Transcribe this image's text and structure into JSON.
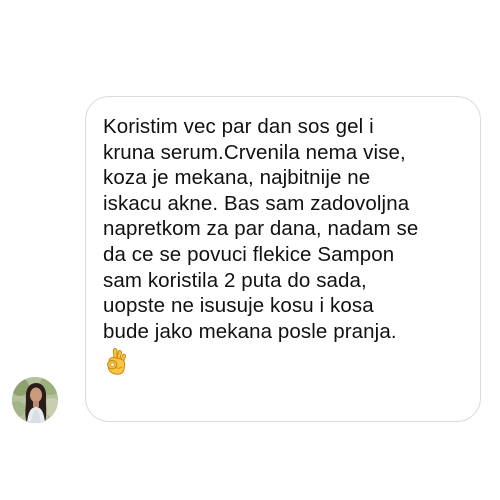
{
  "conversation": {
    "message": {
      "lines": [
        "Koristim vec par dan sos gel i",
        "kruna serum.Crvenila nema vise,",
        "koza je mekana, najbitnije ne",
        "iskacu akne. Bas sam zadovoljna",
        "napretkom za par dana, nadam se",
        "da ce se povuci flekice Sampon",
        "sam koristila 2 puta do sada,",
        "uopste ne isusuje kosu i kosa",
        "bude jako mekana posle pranja."
      ],
      "emoji": "ok-hand-icon"
    },
    "sender": {
      "avatar_icon": "user-avatar"
    }
  },
  "colors": {
    "bubble_border": "#dbdbdb",
    "text": "#111111",
    "background": "#ffffff",
    "emoji": "#f5c33b"
  }
}
